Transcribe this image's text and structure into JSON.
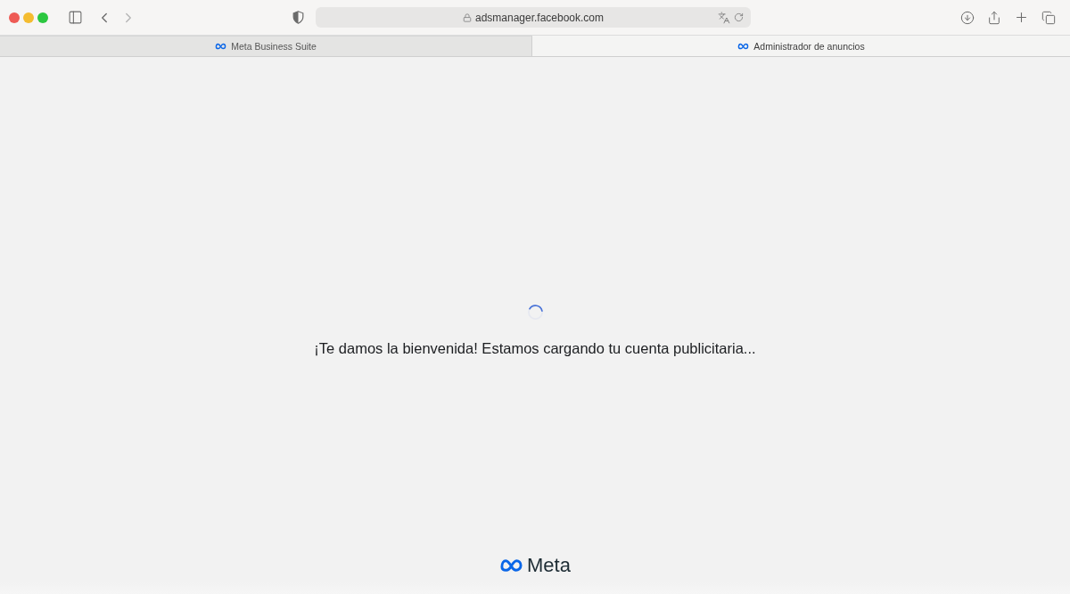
{
  "toolbar": {
    "navigation": [
      {
        "kind": "back",
        "disabled": false
      },
      {
        "kind": "forward",
        "disabled": true
      }
    ],
    "url": "adsmanager.facebook.com"
  },
  "tabs": [
    {
      "label": "Meta Business Suite",
      "selected": false
    },
    {
      "label": "Administrador de anuncios",
      "selected": true
    }
  ],
  "page": {
    "loading": true,
    "message": "¡Te damos la bienvenida! Estamos cargando tu cuenta publicitaria...",
    "footer_brand": "Meta"
  }
}
